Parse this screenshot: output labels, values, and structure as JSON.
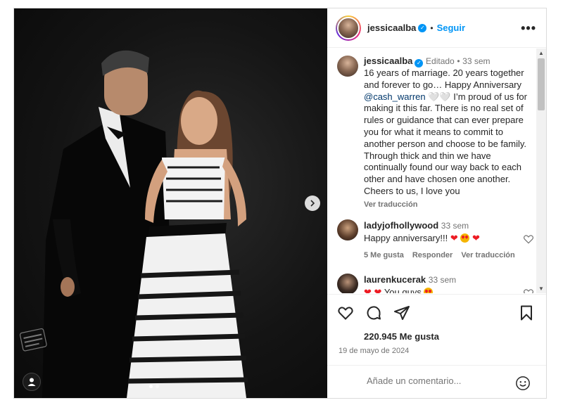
{
  "post": {
    "username": "jessicaalba",
    "follow_label": "Seguir",
    "more_label": "•••",
    "caption": {
      "username": "jessicaalba",
      "edited": "Editado",
      "time": "33 sem",
      "text_before": "16 years of marriage. 20 years together and forever to go… Happy Anniversary ",
      "mention": "@cash_warren",
      "text_after": " 🤍🤍 I’m proud of us for making it this far. There is no real set of rules or guidance that can ever prepare you for what it means to commit to another person and choose to be family. Through thick and thin we have continually found our way back to each other and have chosen one another. Cheers to us, I love you",
      "translate": "Ver traducción"
    },
    "comments": [
      {
        "username": "ladyjofhollywood",
        "time": "33 sem",
        "text": "Happy anniversary!!! ",
        "likes": "5 Me gusta",
        "reply": "Responder",
        "translate": "Ver traducción"
      },
      {
        "username": "laurenkucerak",
        "time": "33 sem",
        "text": " You guys "
      }
    ],
    "likes_count": "220.945 Me gusta",
    "date": "19 de mayo de 2024",
    "comment_placeholder": "Añade un comentario...",
    "icons": {
      "like": "heart-icon",
      "comment": "comment-icon",
      "share": "share-icon",
      "save": "bookmark-icon",
      "emoji": "emoji-icon",
      "next": "chevron-right-icon",
      "tag": "user-tag-icon",
      "verified": "verified-badge-icon"
    },
    "carousel": {
      "slides": 2,
      "active": 1
    },
    "colors": {
      "accent": "#0095f6",
      "text": "#262626",
      "muted": "#737373",
      "heart": "#ed1c24"
    }
  }
}
